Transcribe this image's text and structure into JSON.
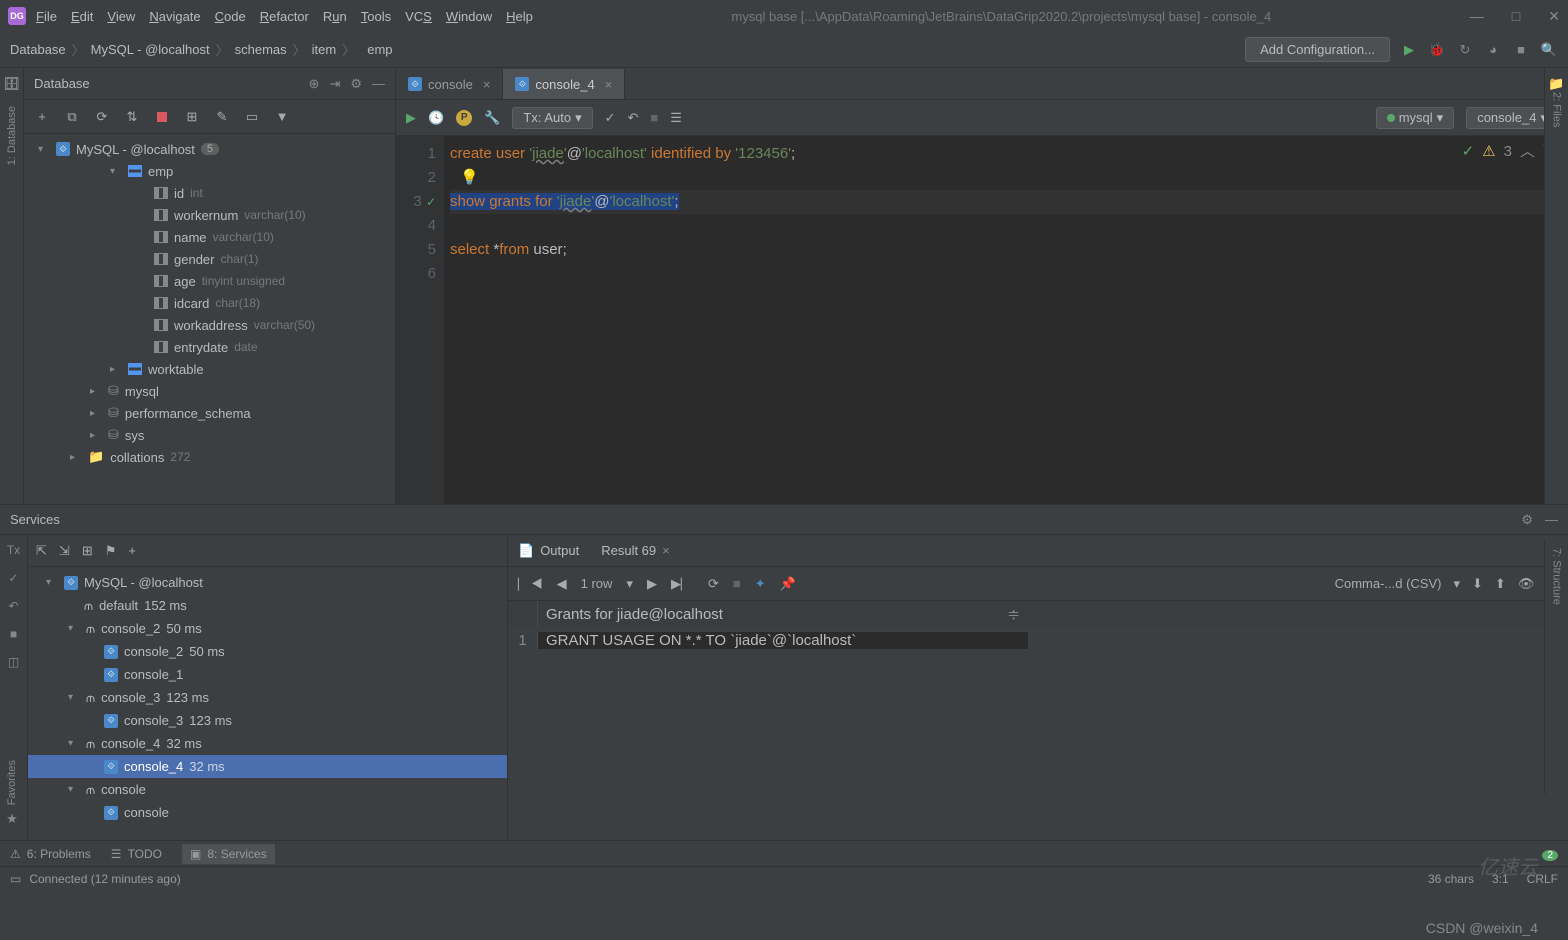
{
  "title": "mysql base [...\\AppData\\Roaming\\JetBrains\\DataGrip2020.2\\projects\\mysql base] - console_4",
  "menu": [
    "File",
    "Edit",
    "View",
    "Navigate",
    "Code",
    "Refactor",
    "Run",
    "Tools",
    "VCS",
    "Window",
    "Help"
  ],
  "breadcrumb": [
    "Database",
    "MySQL - @localhost",
    "schemas",
    "item",
    "emp"
  ],
  "add_config": "Add Configuration...",
  "db_panel": {
    "title": "Database"
  },
  "db_tree": {
    "root": {
      "label": "MySQL - @localhost",
      "badge": "5"
    },
    "emp": "emp",
    "cols": [
      {
        "name": "id",
        "type": "int"
      },
      {
        "name": "workernum",
        "type": "varchar(10)"
      },
      {
        "name": "name",
        "type": "varchar(10)"
      },
      {
        "name": "gender",
        "type": "char(1)"
      },
      {
        "name": "age",
        "type": "tinyint unsigned"
      },
      {
        "name": "idcard",
        "type": "char(18)"
      },
      {
        "name": "workaddress",
        "type": "varchar(50)"
      },
      {
        "name": "entrydate",
        "type": "date"
      }
    ],
    "worktable": "worktable",
    "schemas": [
      "mysql",
      "performance_schema",
      "sys"
    ],
    "collations": {
      "label": "collations",
      "count": "272"
    }
  },
  "tabs": [
    {
      "label": "console",
      "active": false
    },
    {
      "label": "console_4",
      "active": true
    }
  ],
  "tx_label": "Tx: Auto",
  "datasource": "mysql",
  "console_sel": "console_4",
  "inspection_count": "3",
  "code": {
    "l1_a": "create",
    "l1_b": "user",
    "l1_s1": "'",
    "l1_u": "jiade",
    "l1_s2": "'",
    "l1_at": "@",
    "l1_s3": "'localhost'",
    "l1_c": "identified",
    "l1_d": "by",
    "l1_s4": "'123456'",
    "l1_semi": ";",
    "l3_a": "show",
    "l3_b": "grants",
    "l3_c": "for",
    "l3_s1": "'",
    "l3_u": "jiade",
    "l3_s2": "'",
    "l3_at": "@",
    "l3_s3": "'localhost'",
    "l3_semi": ";",
    "l5_a": "select",
    "l5_b": "*",
    "l5_c": "from",
    "l5_d": "user",
    "l5_semi": ";"
  },
  "services": {
    "title": "Services",
    "tx": "Tx",
    "root": "MySQL - @localhost",
    "items": [
      {
        "label": "default",
        "time": "152 ms",
        "indent": 1
      },
      {
        "label": "console_2",
        "time": "50 ms",
        "indent": 1,
        "exp": true
      },
      {
        "label": "console_2",
        "time": "50 ms",
        "indent": 2
      },
      {
        "label": "console_1",
        "time": "",
        "indent": 2
      },
      {
        "label": "console_3",
        "time": "123 ms",
        "indent": 1,
        "exp": true
      },
      {
        "label": "console_3",
        "time": "123 ms",
        "indent": 2
      },
      {
        "label": "console_4",
        "time": "32 ms",
        "indent": 1,
        "exp": true
      },
      {
        "label": "console_4",
        "time": "32 ms",
        "indent": 2,
        "sel": true
      },
      {
        "label": "console",
        "time": "",
        "indent": 1,
        "exp": true
      },
      {
        "label": "console",
        "time": "",
        "indent": 2
      }
    ],
    "output_tab": "Output",
    "result_tab": "Result 69",
    "rows_label": "1 row",
    "format": "Comma-...d (CSV)",
    "col_header": "Grants for jiade@localhost",
    "row_num": "1",
    "cell": "GRANT USAGE ON *.* TO `jiade`@`localhost`"
  },
  "bottom_tabs": {
    "problems": "6: Problems",
    "todo": "TODO",
    "services": "8: Services"
  },
  "status": {
    "msg": "Connected (12 minutes ago)",
    "chars": "36 chars",
    "pos": "3:1",
    "crlf": "CRLF"
  },
  "right_labels": {
    "files": "2: Files",
    "structure": "7: Structure",
    "favorites": "Favorites"
  },
  "watermark": "亿速云",
  "watermark2": "CSDN @weixin_4"
}
